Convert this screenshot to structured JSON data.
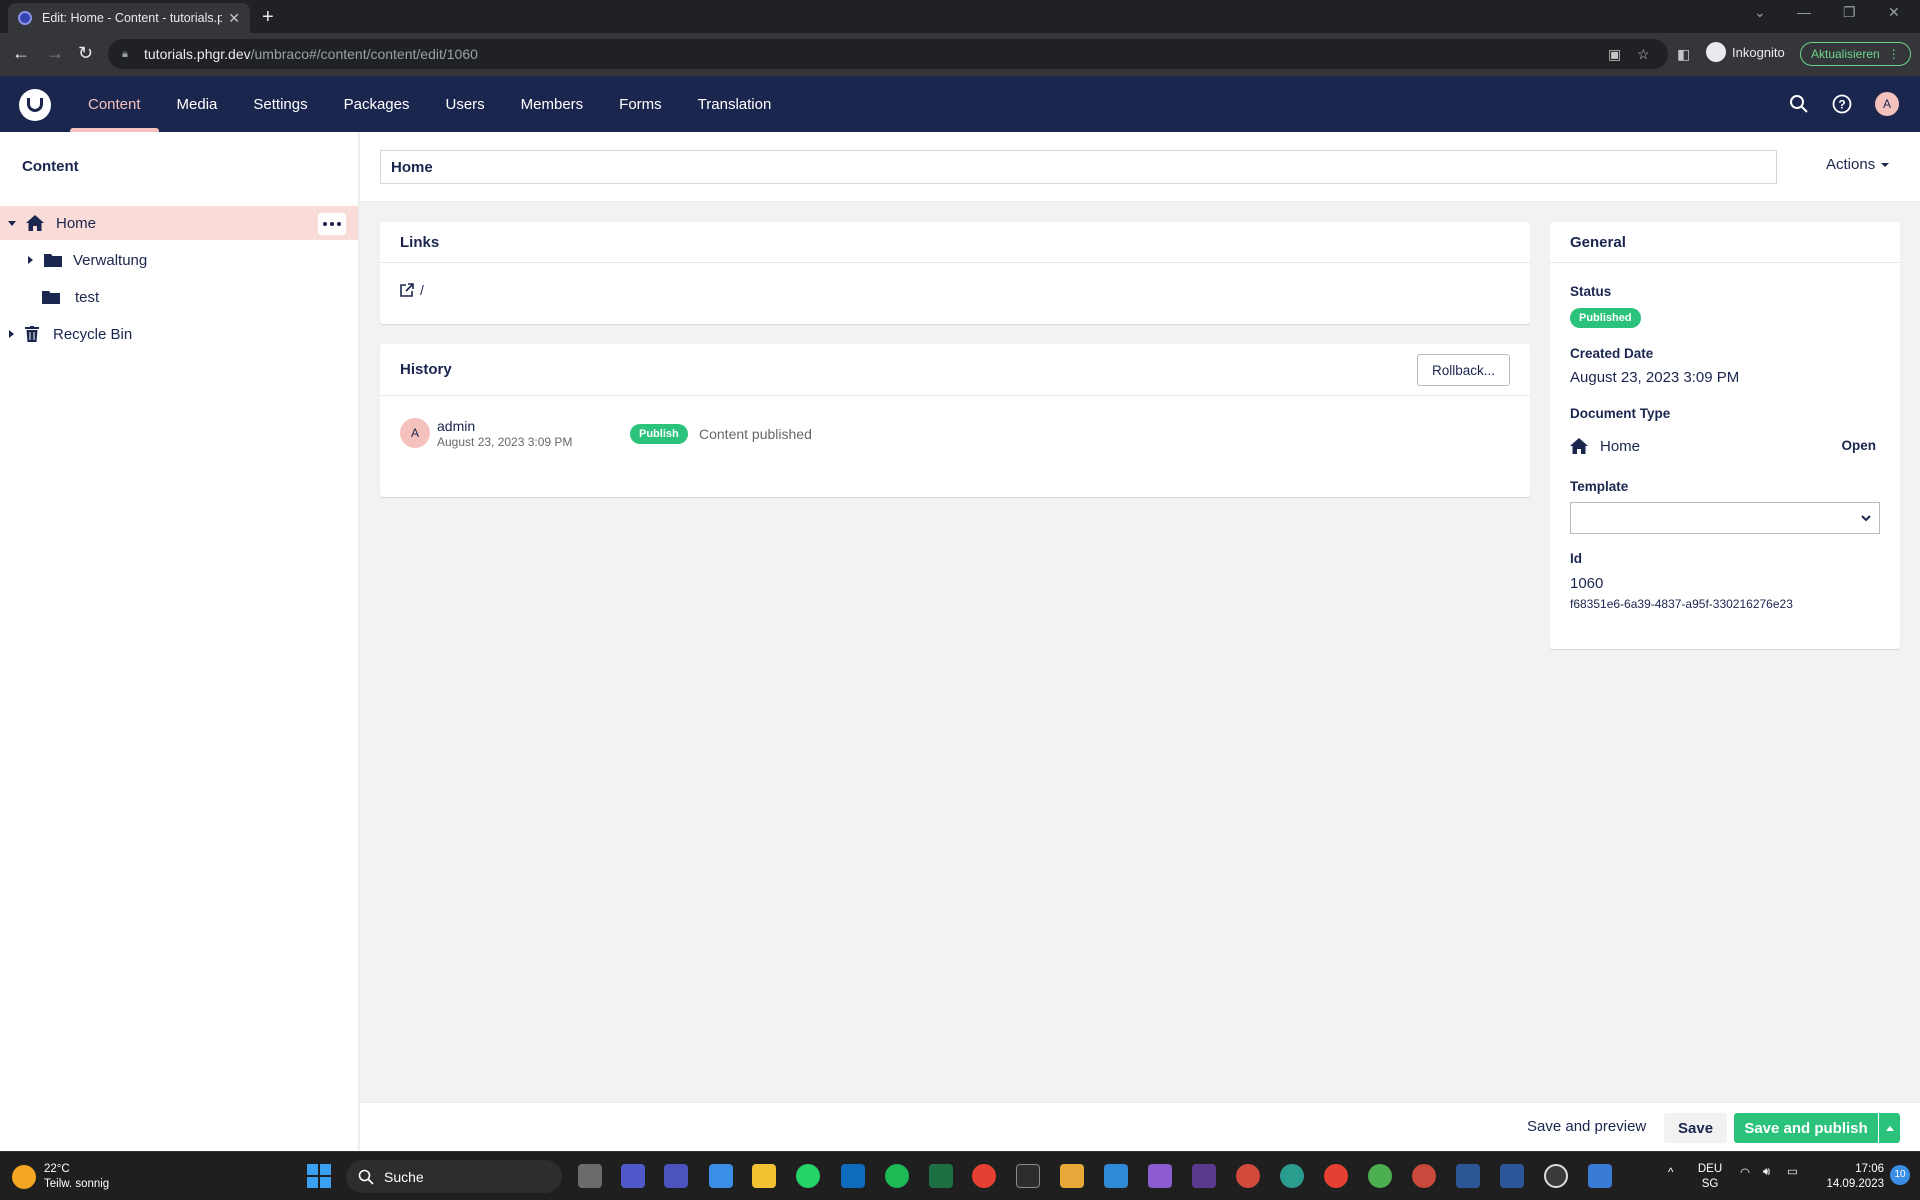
{
  "browser": {
    "tab_title": "Edit: Home - Content - tutorials.phgr.dev",
    "url_host": "tutorials.phgr.dev",
    "url_path": "/umbraco#/content/content/edit/1060",
    "incognito_label": "Inkognito",
    "update_label": "Aktualisieren"
  },
  "header": {
    "sections": [
      "Content",
      "Media",
      "Settings",
      "Packages",
      "Users",
      "Members",
      "Forms",
      "Translation"
    ],
    "active_section": "Content",
    "user_initial": "A"
  },
  "tree": {
    "title": "Content",
    "items": [
      {
        "label": "Home",
        "icon": "home-icon"
      },
      {
        "label": "Verwaltung",
        "icon": "folder-icon"
      },
      {
        "label": "test",
        "icon": "folder-icon"
      },
      {
        "label": "Recycle Bin",
        "icon": "trash-icon"
      }
    ]
  },
  "editor": {
    "name": "Home",
    "actions_label": "Actions",
    "links": {
      "title": "Links",
      "url": "/"
    },
    "history": {
      "title": "History",
      "rollback_label": "Rollback...",
      "entries": [
        {
          "user": "admin",
          "user_initial": "A",
          "date": "August 23, 2023 3:09 PM",
          "badge": "Publish",
          "message": "Content published"
        }
      ]
    },
    "general": {
      "title": "General",
      "status_label": "Status",
      "status_value": "Published",
      "created_label": "Created Date",
      "created_value": "August 23, 2023 3:09 PM",
      "doctype_label": "Document Type",
      "doctype_value": "Home",
      "doctype_open": "Open",
      "template_label": "Template",
      "template_value": "",
      "id_label": "Id",
      "id_value": "1060",
      "guid": "f68351e6-6a39-4837-a95f-330216276e23"
    }
  },
  "footer": {
    "preview_label": "Save and preview",
    "save_label": "Save",
    "publish_label": "Save and publish"
  },
  "taskbar": {
    "temperature": "22°C",
    "weather": "Teilw. sonnig",
    "search_label": "Suche",
    "lang_top": "DEU",
    "lang_bottom": "SG",
    "time": "17:06",
    "date": "14.09.2023",
    "notification_count": "10"
  },
  "colors": {
    "header_bg": "#1b264f",
    "accent_pink": "#f5c1bc",
    "green": "#2bc37c",
    "selected_tree_bg": "#f9dbd8"
  }
}
